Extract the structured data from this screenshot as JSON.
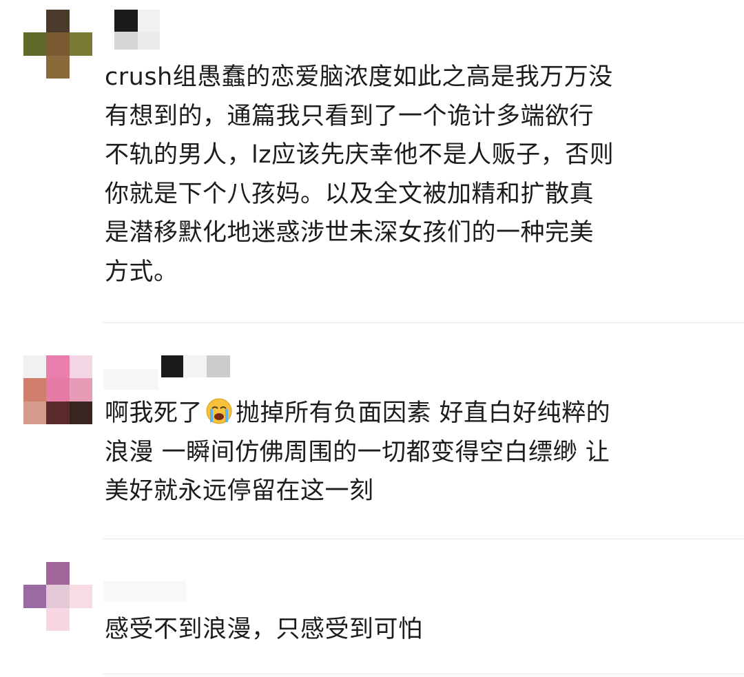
{
  "comments": [
    {
      "lines": [
        "crush组愚蠢的恋爱脑浓度如此之高是我万万没",
        "有想到的，通篇我只看到了一个诡计多端欲行",
        "不轨的男人，lz应该先庆幸他不是人贩子，否则",
        "你就是下个八孩妈。以及全文被加精和扩散真",
        "是潜移默化地迷惑涉世未深女孩们的一种完美",
        "方式。"
      ]
    },
    {
      "line1_before_emoji": "啊我死了",
      "emoji": "loudly-crying-face",
      "line1_after_emoji": "抛掉所有负面因素 好直白好纯粹的",
      "lines_rest": [
        "浪漫 一瞬间仿佛周围的一切都变得空白缥缈 让",
        "美好就永远停留在这一刻"
      ]
    },
    {
      "lines": [
        "感受不到浪漫，只感受到可怕"
      ]
    }
  ],
  "colors": {
    "text": "#1c1c1c",
    "divider": "#e6e6e6",
    "emoji_face": "#f5c33b"
  }
}
